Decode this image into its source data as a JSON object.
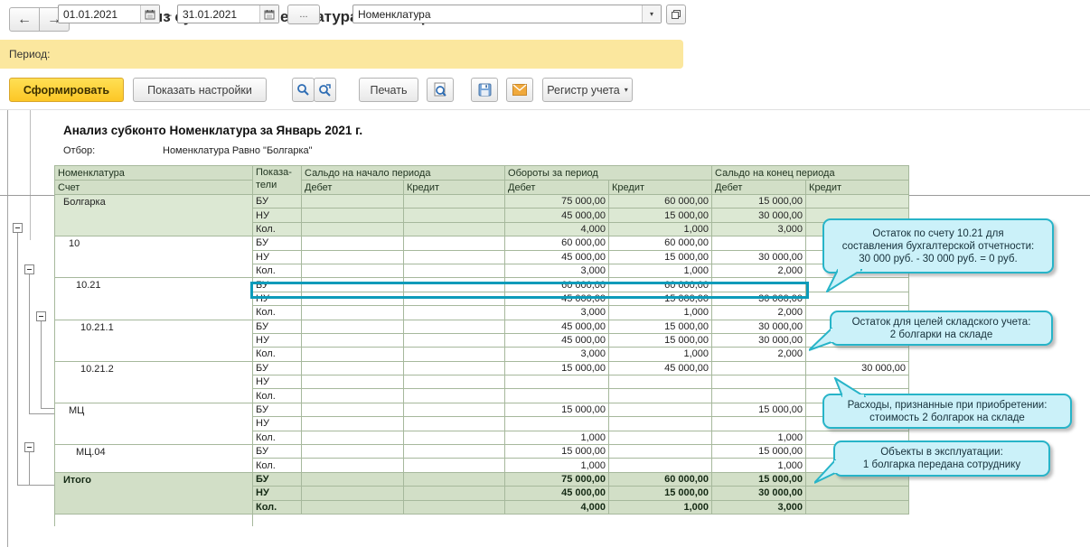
{
  "window": {
    "title": "Анализ субконто Номенклатура за Январь 2021 г."
  },
  "filter_bar": {
    "period_label": "Период:",
    "date_from": "01.01.2021",
    "dash": "–",
    "date_to": "31.01.2021",
    "more_button": "...",
    "subconto_value": "Номенклатура"
  },
  "toolbar": {
    "generate": "Сформировать",
    "show_settings": "Показать настройки",
    "print": "Печать",
    "register": "Регистр учета"
  },
  "report": {
    "title": "Анализ субконто Номенклатура за Январь 2021 г.",
    "filter_label": "Отбор:",
    "filter_value": "Номенклатура Равно \"Болгарка\"",
    "header": {
      "col1_line1": "Номенклатура",
      "col1_line2": "Счет",
      "col2_line1": "Показа-",
      "col2_line2": "тели",
      "opening": "Сальдо на начало периода",
      "turnover": "Обороты за период",
      "closing": "Сальдо на конец периода",
      "debit": "Дебет",
      "credit": "Кредит"
    },
    "groups": [
      {
        "account": "Болгарка",
        "level": 0,
        "style": "group",
        "rows": [
          [
            "БУ",
            "",
            "",
            "75 000,00",
            "60 000,00",
            "15 000,00",
            ""
          ],
          [
            "НУ",
            "",
            "",
            "45 000,00",
            "15 000,00",
            "30 000,00",
            ""
          ],
          [
            "Кол.",
            "",
            "",
            "4,000",
            "1,000",
            "3,000",
            ""
          ]
        ]
      },
      {
        "account": "10",
        "level": 1,
        "style": "detail",
        "rows": [
          [
            "БУ",
            "",
            "",
            "60 000,00",
            "60 000,00",
            "",
            ""
          ],
          [
            "НУ",
            "",
            "",
            "45 000,00",
            "15 000,00",
            "30 000,00",
            ""
          ],
          [
            "Кол.",
            "",
            "",
            "3,000",
            "1,000",
            "2,000",
            ""
          ]
        ]
      },
      {
        "account": "10.21",
        "level": 2,
        "style": "detail",
        "rows": [
          [
            "БУ",
            "",
            "",
            "60 000,00",
            "60 000,00",
            "",
            ""
          ],
          [
            "НУ",
            "",
            "",
            "45 000,00",
            "15 000,00",
            "30 000,00",
            ""
          ],
          [
            "Кол.",
            "",
            "",
            "3,000",
            "1,000",
            "2,000",
            ""
          ]
        ]
      },
      {
        "account": "10.21.1",
        "level": 3,
        "style": "detail",
        "rows": [
          [
            "БУ",
            "",
            "",
            "45 000,00",
            "15 000,00",
            "30 000,00",
            ""
          ],
          [
            "НУ",
            "",
            "",
            "45 000,00",
            "15 000,00",
            "30 000,00",
            ""
          ],
          [
            "Кол.",
            "",
            "",
            "3,000",
            "1,000",
            "2,000",
            ""
          ]
        ]
      },
      {
        "account": "10.21.2",
        "level": 3,
        "style": "detail",
        "rows": [
          [
            "БУ",
            "",
            "",
            "15 000,00",
            "45 000,00",
            "",
            "30 000,00"
          ],
          [
            "НУ",
            "",
            "",
            "",
            "",
            "",
            ""
          ],
          [
            "Кол.",
            "",
            "",
            "",
            "",
            "",
            ""
          ]
        ]
      },
      {
        "account": "МЦ",
        "level": 1,
        "style": "detail",
        "rows": [
          [
            "БУ",
            "",
            "",
            "15 000,00",
            "",
            "15 000,00",
            ""
          ],
          [
            "НУ",
            "",
            "",
            "",
            "",
            "",
            ""
          ],
          [
            "Кол.",
            "",
            "",
            "1,000",
            "",
            "1,000",
            ""
          ]
        ]
      },
      {
        "account": "МЦ.04",
        "level": 2,
        "style": "detail",
        "rows": [
          [
            "БУ",
            "",
            "",
            "15 000,00",
            "",
            "15 000,00",
            ""
          ],
          [
            "Кол.",
            "",
            "",
            "1,000",
            "",
            "1,000",
            ""
          ]
        ]
      },
      {
        "account": "Итого",
        "level": 0,
        "style": "total",
        "rows": [
          [
            "БУ",
            "",
            "",
            "75 000,00",
            "60 000,00",
            "15 000,00",
            ""
          ],
          [
            "НУ",
            "",
            "",
            "45 000,00",
            "15 000,00",
            "30 000,00",
            ""
          ],
          [
            "Кол.",
            "",
            "",
            "4,000",
            "1,000",
            "3,000",
            ""
          ]
        ]
      }
    ],
    "callouts": [
      {
        "lines": [
          "Остаток по счету 10.21 для",
          "составления бухгалтерской отчетности:",
          "30 000 руб. - 30 000 руб. = 0 руб."
        ]
      },
      {
        "lines": [
          "Остаток для целей складского учета:",
          "2 болгарки на складе"
        ]
      },
      {
        "lines": [
          "Расходы, признанные при приобретении:",
          "стоимость 2 болгарок на складе"
        ]
      },
      {
        "lines": [
          "Объекты в эксплуатации:",
          "1 болгарка передана сотруднику"
        ]
      }
    ],
    "colors": {
      "accent_yellow": "#fbe79e",
      "generate_yellow": "#fcc725",
      "header_green": "#d2dfc7",
      "selection_teal": "#0d9bba",
      "callout_cyan": "#cbf1f9",
      "callout_border": "#27b4c8"
    }
  }
}
